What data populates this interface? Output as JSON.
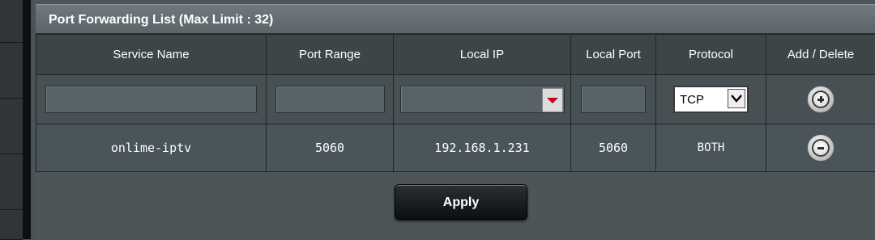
{
  "panel": {
    "title": "Port Forwarding List (Max Limit : 32)"
  },
  "columns": [
    "Service Name",
    "Port Range",
    "Local IP",
    "Local Port",
    "Protocol",
    "Add / Delete"
  ],
  "input_row": {
    "service_name": "",
    "port_range": "",
    "local_ip": "",
    "local_port": "",
    "protocol": "TCP",
    "action_icon": "add-circle-icon"
  },
  "rules": [
    {
      "service_name": "onlime-iptv",
      "port_range": "5060",
      "local_ip": "192.168.1.231",
      "local_port": "5060",
      "protocol": "BOTH",
      "action_icon": "remove-circle-icon"
    }
  ],
  "apply_label": "Apply"
}
